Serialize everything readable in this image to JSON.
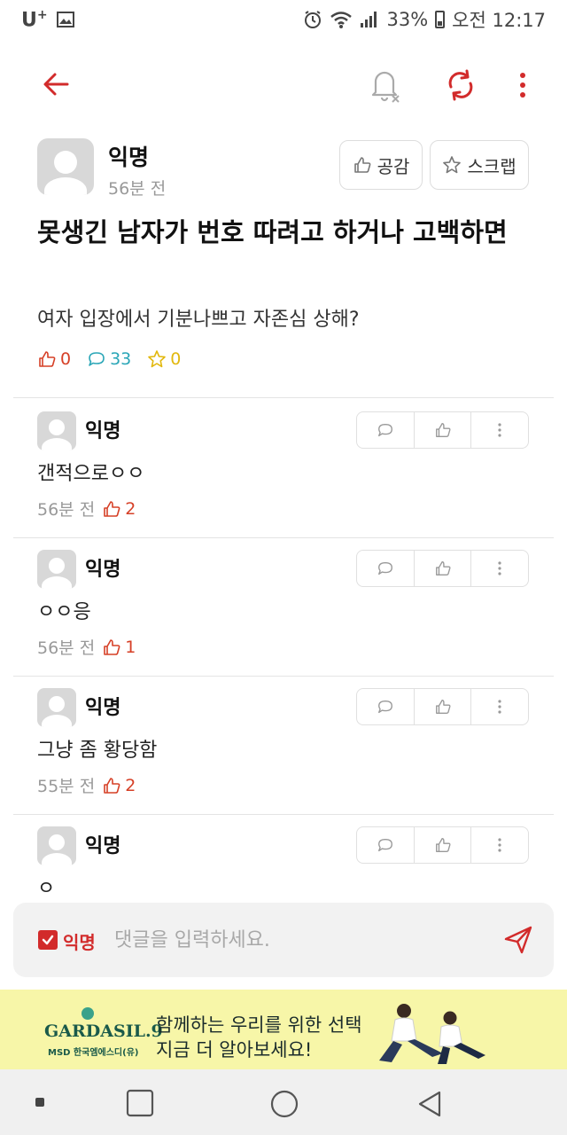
{
  "status_bar": {
    "carrier": "U",
    "carrier_sup": "+",
    "battery": "33%",
    "time": "오전 12:17"
  },
  "post": {
    "author": "익명",
    "time": "56분 전",
    "empathy_label": "공감",
    "scrap_label": "스크랩",
    "title": "못생긴 남자가 번호 따려고 하거나 고백하면",
    "body": "여자 입장에서 기분나쁘고 자존심 상해?",
    "likes": "0",
    "comments": "33",
    "scraps": "0"
  },
  "comments": [
    {
      "author": "익명",
      "text": "갠적으로ㅇㅇ",
      "time": "56분 전",
      "likes": "2"
    },
    {
      "author": "익명",
      "text": "ㅇㅇ응",
      "time": "56분 전",
      "likes": "1"
    },
    {
      "author": "익명",
      "text": "그냥 좀 황당함",
      "time": "55분 전",
      "likes": "2"
    },
    {
      "author": "익명",
      "text": "ㅇ",
      "time": "",
      "likes": ""
    }
  ],
  "comment_input": {
    "anonymous_label": "익명",
    "placeholder": "댓글을 입력하세요."
  },
  "ad": {
    "brand": "GARDASIL.9",
    "sponsor": "MSD 한국엠에스디(유)",
    "line1": "함께하는 우리를 위한 선택",
    "line2": "지금 더 알아보세요!"
  },
  "colors": {
    "accent_red": "#d22b2b",
    "comment_teal": "#2aa6b7",
    "scrap_yellow": "#e2b80e",
    "ad_background": "#f7f6a8"
  }
}
